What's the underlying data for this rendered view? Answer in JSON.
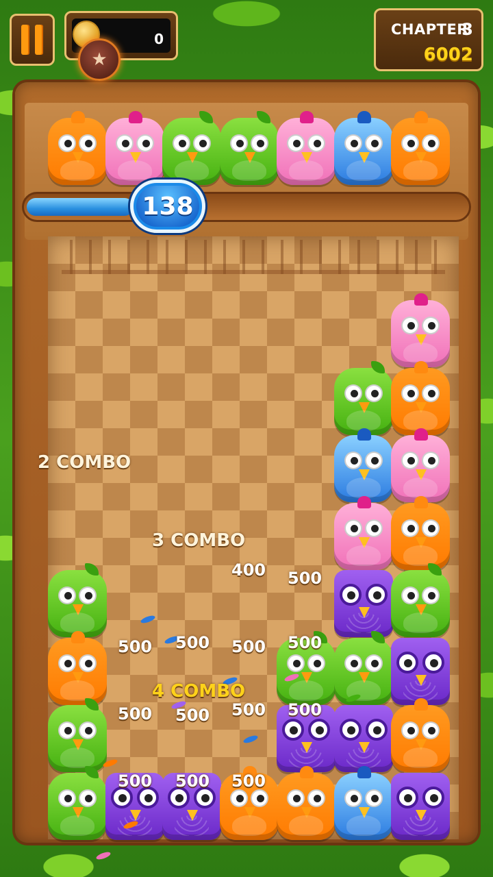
{
  "hud": {
    "coins": "0",
    "chapter_label": "CHAPTER",
    "chapter_number": "3",
    "score": "6002",
    "moves_left": "138",
    "progress_fraction": 0.24
  },
  "next_row": [
    "orange",
    "pink",
    "green",
    "green",
    "pink",
    "blue",
    "orange"
  ],
  "board": {
    "cells": [
      {
        "type": "pink",
        "col": 6,
        "row": 0
      },
      {
        "type": "green",
        "col": 5,
        "row": 1
      },
      {
        "type": "orange",
        "col": 6,
        "row": 1
      },
      {
        "type": "blue",
        "col": 5,
        "row": 2
      },
      {
        "type": "pink",
        "col": 6,
        "row": 2
      },
      {
        "type": "pink",
        "col": 5,
        "row": 3
      },
      {
        "type": "orange",
        "col": 6,
        "row": 3
      },
      {
        "type": "green",
        "col": 0,
        "row": 4
      },
      {
        "type": "purple",
        "col": 5,
        "row": 4
      },
      {
        "type": "green",
        "col": 6,
        "row": 4
      },
      {
        "type": "orange",
        "col": 0,
        "row": 5
      },
      {
        "type": "green",
        "col": 4,
        "row": 5
      },
      {
        "type": "green",
        "col": 5,
        "row": 5
      },
      {
        "type": "purple",
        "col": 6,
        "row": 5
      },
      {
        "type": "green",
        "col": 0,
        "row": 6
      },
      {
        "type": "purple",
        "col": 4,
        "row": 6
      },
      {
        "type": "purple",
        "col": 5,
        "row": 6
      },
      {
        "type": "orange",
        "col": 6,
        "row": 6
      },
      {
        "type": "green",
        "col": 0,
        "row": 7
      },
      {
        "type": "purple",
        "col": 1,
        "row": 7
      },
      {
        "type": "purple",
        "col": 2,
        "row": 7
      },
      {
        "type": "orange",
        "col": 3,
        "row": 7
      },
      {
        "type": "orange",
        "col": 4,
        "row": 7
      },
      {
        "type": "blue",
        "col": 5,
        "row": 7
      },
      {
        "type": "purple",
        "col": 6,
        "row": 7
      }
    ]
  },
  "popups": {
    "combo_2": "2 COMBO",
    "combo_3": "3 COMBO",
    "combo_4": "4 COMBO",
    "p400": "400",
    "p500": "500"
  }
}
